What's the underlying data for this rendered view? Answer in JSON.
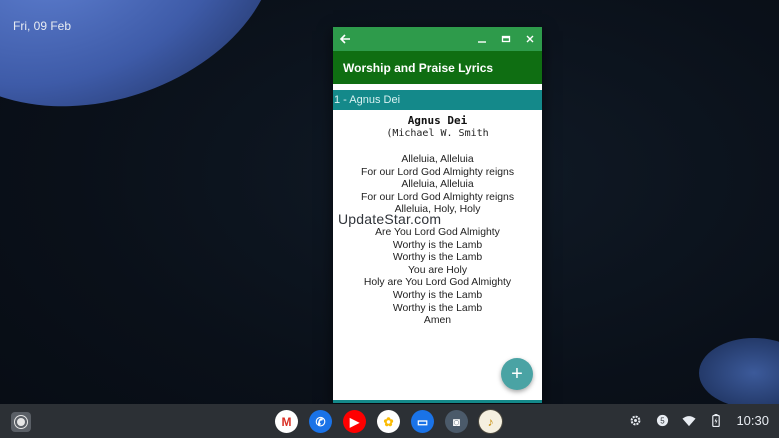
{
  "desktop": {
    "date": "Fri, 09 Feb"
  },
  "app": {
    "title": "Worship and Praise Lyrics",
    "song_bar": "1 - Agnus Dei",
    "song": {
      "title": "Agnus Dei",
      "author": "(Michael W. Smith",
      "stanza1": [
        "Alleluia, Alleluia",
        "For our Lord God Almighty reigns",
        "Alleluia, Alleluia",
        "For our Lord God Almighty reigns",
        "Alleluia, Holy, Holy"
      ],
      "stanza2": [
        "Are You Lord God Almighty",
        "Worthy is the Lamb",
        "Worthy is the Lamb",
        "You are Holy",
        "Holy are You Lord God Almighty",
        "Worthy is the Lamb",
        "Worthy is the Lamb",
        "Amen"
      ]
    },
    "fab_label": "+"
  },
  "watermark": "UpdateStar.com",
  "shelf": {
    "apps": [
      {
        "name": "gmail-icon",
        "glyph": "M",
        "bg": "#ffffff",
        "fg": "#d93025"
      },
      {
        "name": "phone-icon",
        "glyph": "✆",
        "bg": "#1a73e8",
        "fg": "#ffffff"
      },
      {
        "name": "youtube-icon",
        "glyph": "▶",
        "bg": "#ff0000",
        "fg": "#ffffff"
      },
      {
        "name": "photos-icon",
        "glyph": "✿",
        "bg": "#ffffff",
        "fg": "#fbbc04"
      },
      {
        "name": "messages-icon",
        "glyph": "▭",
        "bg": "#1a73e8",
        "fg": "#ffffff"
      },
      {
        "name": "android-icon",
        "glyph": "◙",
        "bg": "#4b5a6a",
        "fg": "#ffffff"
      },
      {
        "name": "worship-app-icon",
        "glyph": "♪",
        "bg": "#f5f0e0",
        "fg": "#c58a00"
      }
    ],
    "time": "10:30",
    "status_badge": "5"
  },
  "colors": {
    "titlebar": "#2e9b4b",
    "appbar": "#0f6e12",
    "songbar": "#14898a",
    "fab": "#4aa3a4"
  }
}
